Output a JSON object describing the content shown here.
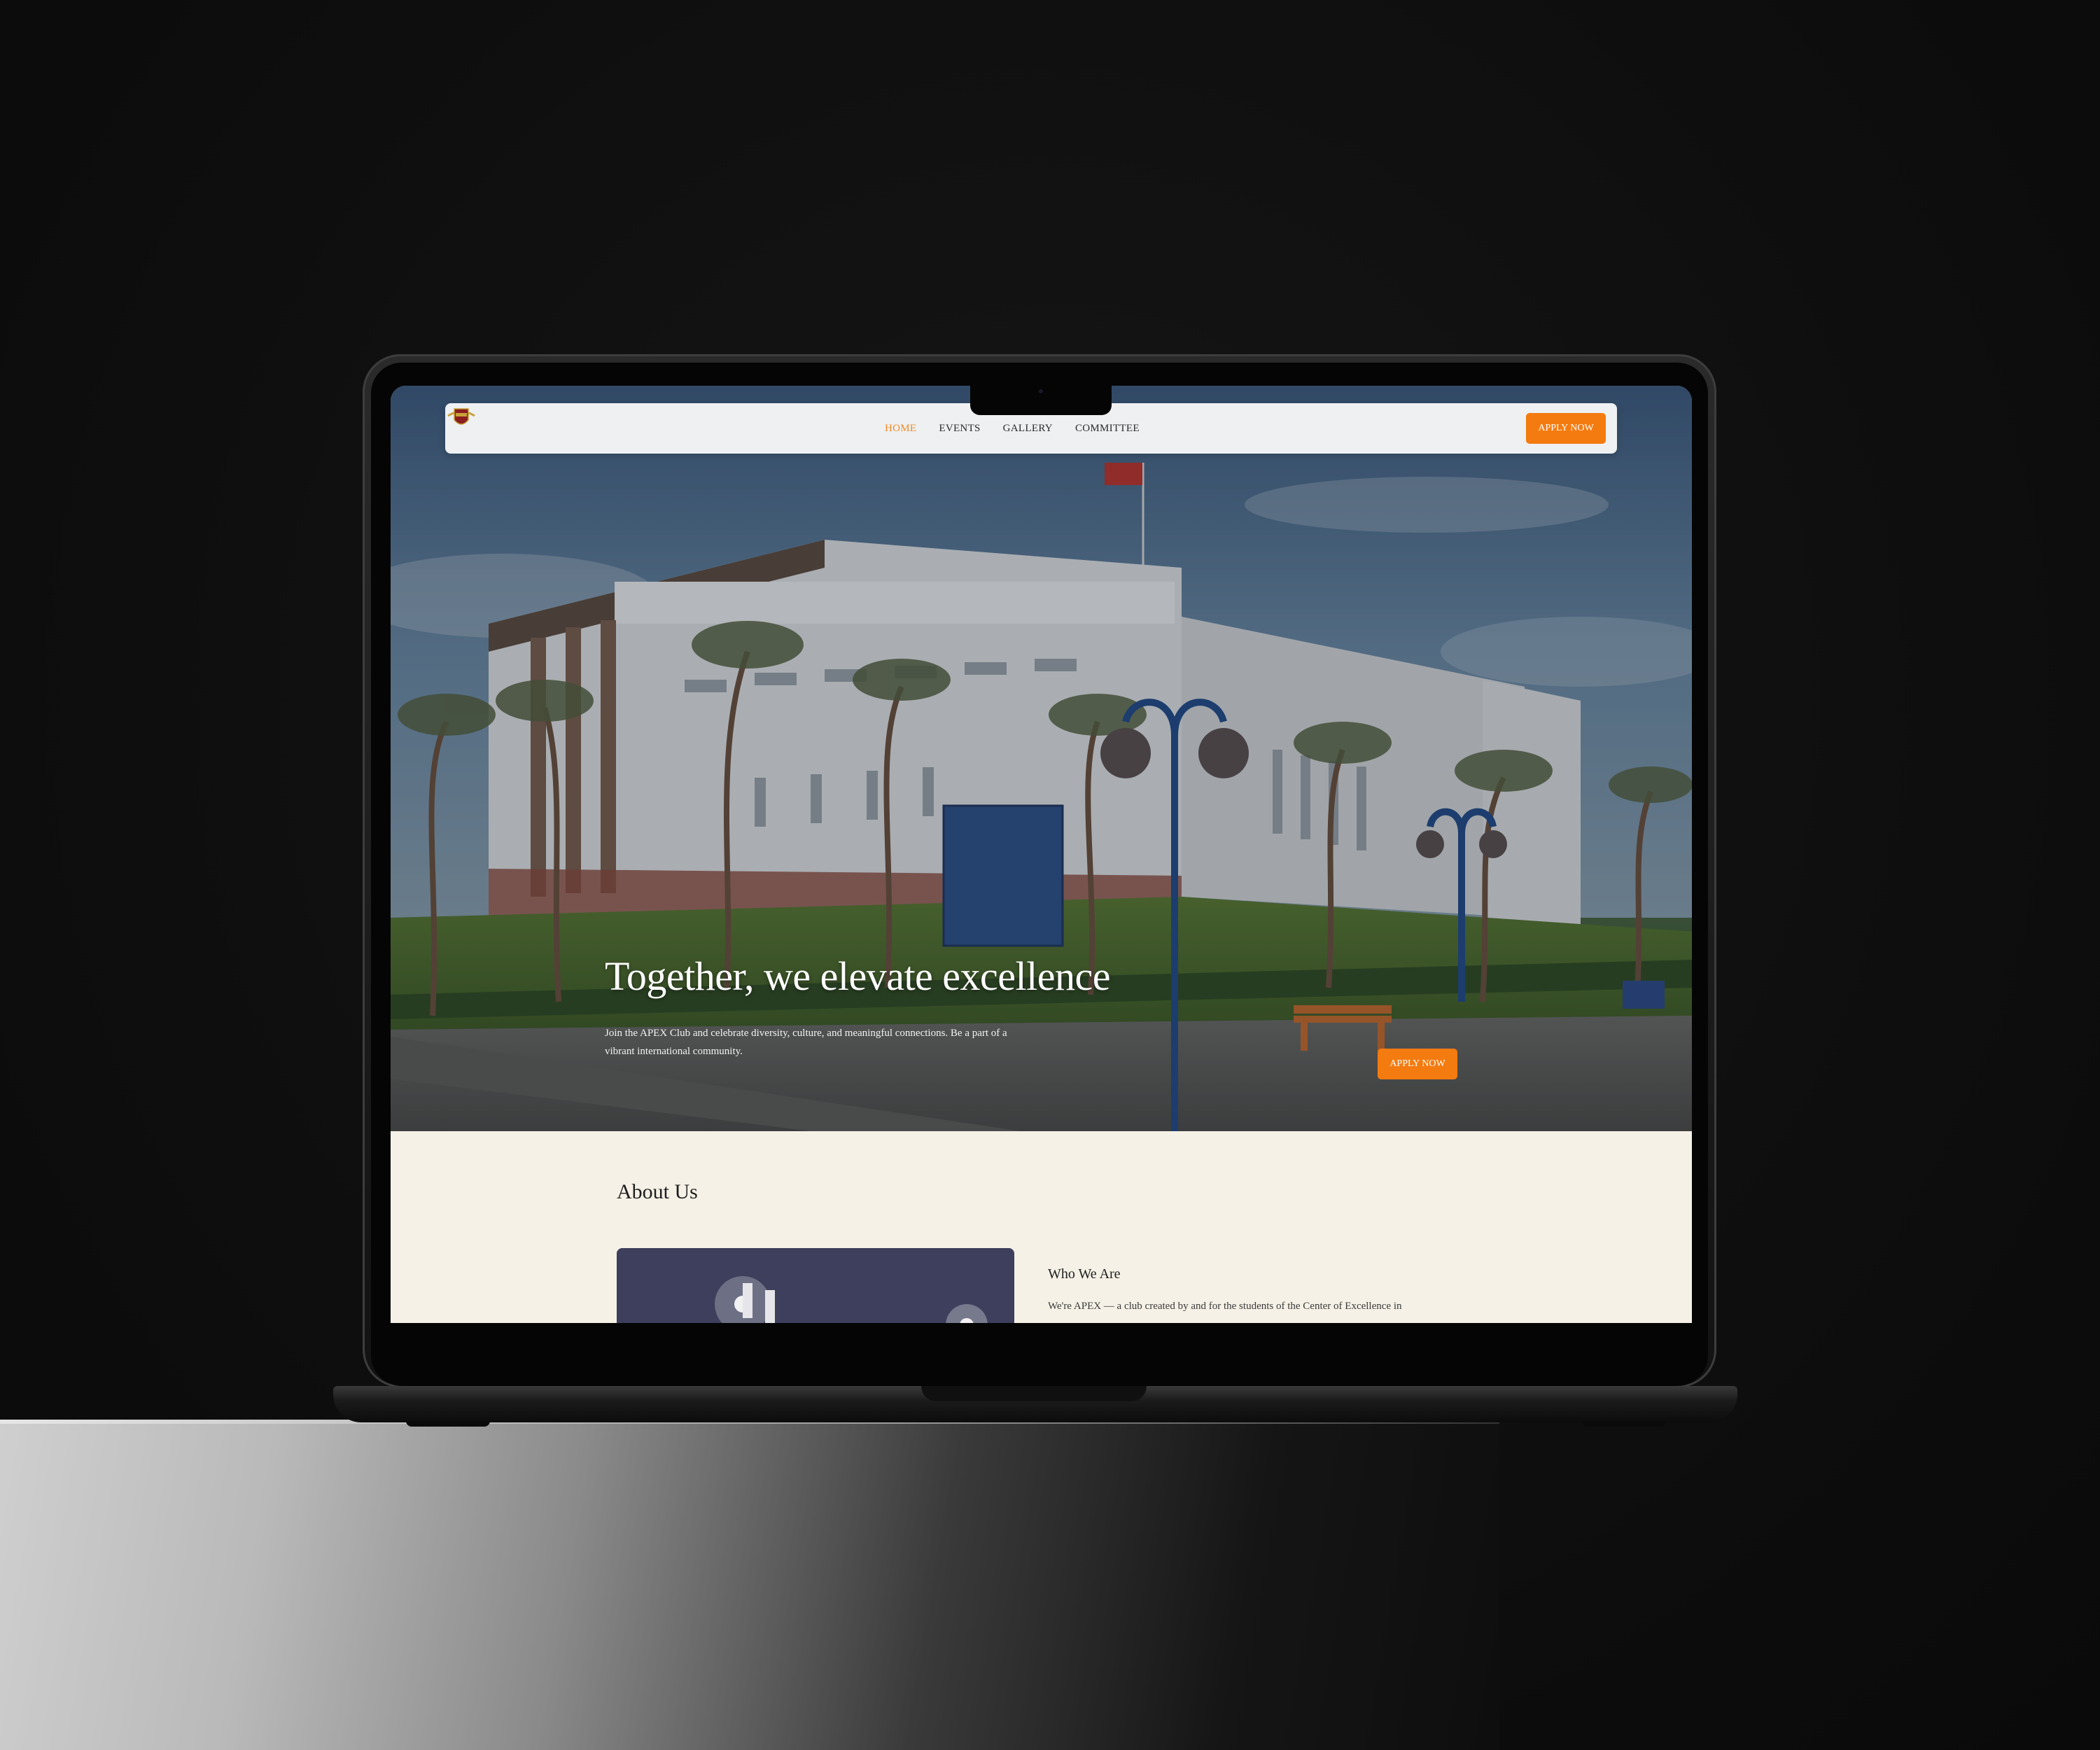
{
  "navbar": {
    "logo_icon": "apex-shield-logo-icon",
    "links": [
      "HOME",
      "EVENTS",
      "GALLERY",
      "COMMITTEE"
    ],
    "active": "HOME",
    "apply_label": "APPLY NOW",
    "accent_color": "#f47b10"
  },
  "hero": {
    "title": "Together, we elevate excellence",
    "subtitle": "Join the APEX Club and celebrate diversity, culture, and meaningful connections. Be a part of a vibrant international community.",
    "apply_label": "APPLY NOW"
  },
  "about": {
    "title": "About Us",
    "who_title": "Who We Are",
    "who_text": "We're APEX — a club created by and for the students of the Center of Excellence in"
  },
  "colors": {
    "about_background": "#f5f1e6",
    "button": "#f47b10",
    "active_link": "#f08a24"
  }
}
